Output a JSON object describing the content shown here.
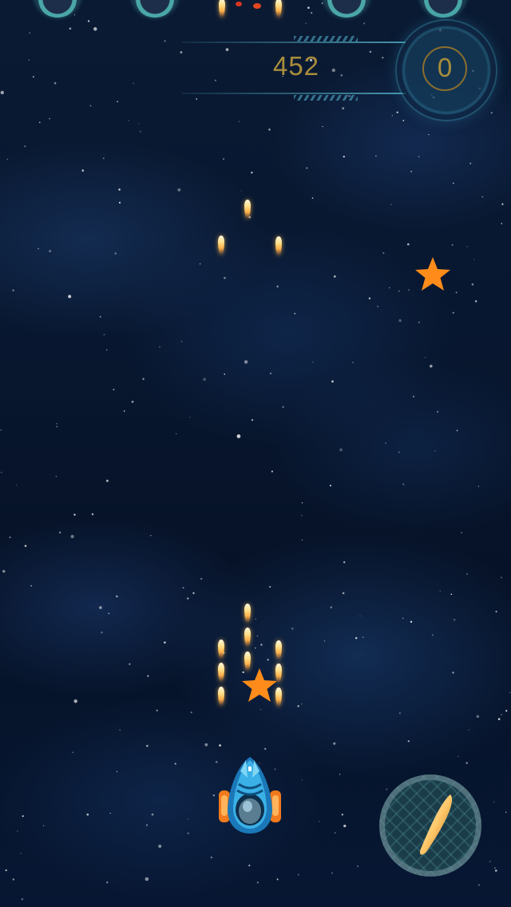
{
  "hud": {
    "score": "452",
    "coins": "0"
  },
  "colors": {
    "hud_text": "#a88d3b",
    "pickup_star": "#ff8c1a",
    "bullet": "#ffd27a",
    "ship": "#3ab0e6"
  },
  "icons": {
    "fire_button": "missile-icon",
    "pickup": "star-icon",
    "enemy": "enemy-ship-icon"
  }
}
